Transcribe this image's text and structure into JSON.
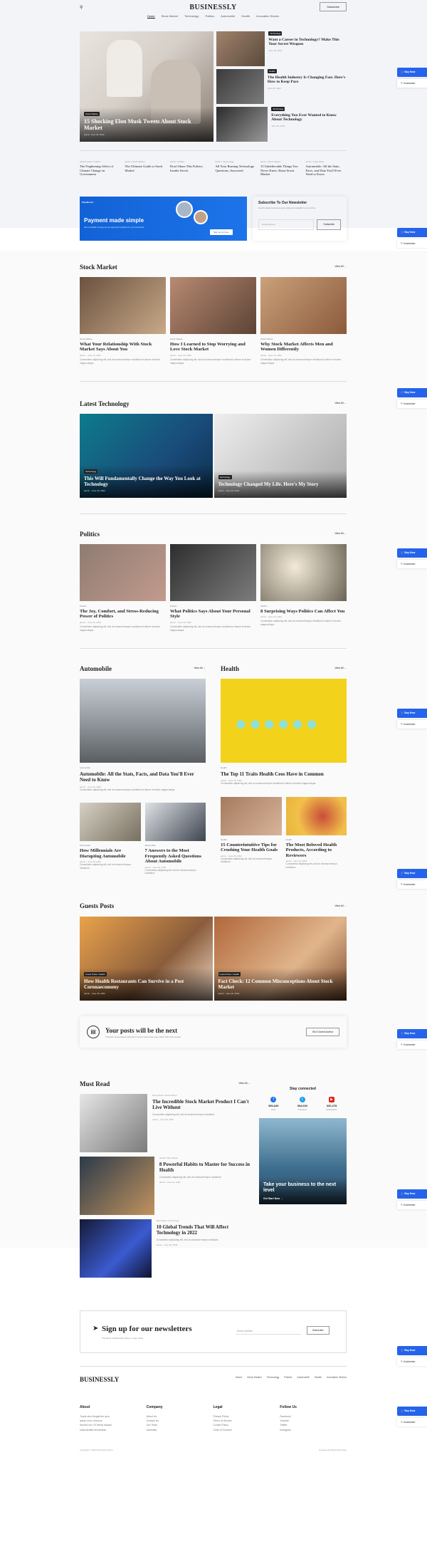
{
  "header": {
    "logo": "BUSINESSLY",
    "subscribe": "Subscribe",
    "nav": [
      "Home",
      "Stock Market",
      "Technology",
      "Politics",
      "Automobile",
      "Health",
      "Innovation Stories"
    ]
  },
  "hero": {
    "main": {
      "tag": "Stock Market",
      "title": "15 Shocking Elon Musk Tweets About Stock Market",
      "author": "admin",
      "date": "June 26, 2022"
    },
    "side": [
      {
        "tag": "Technology",
        "title": "Want a Career in Technology? Make This Your Secret Weapon",
        "date": "June 26, 2022"
      },
      {
        "tag": "Health",
        "title": "The Health Industry Is Changing Fast. Here's How to Keep Pace",
        "date": "June 26, 2022"
      },
      {
        "tag": "Technology",
        "title": "Everything You Ever Wanted to Know About Technology",
        "date": "June 26, 2022"
      }
    ]
  },
  "ticker": [
    {
      "meta": "Global Goals / Politics",
      "title": "The Frightening Affect of Climate Change on Government"
    },
    {
      "meta": "admin / Stock Market",
      "title": "The Ultimate Guide to Stock Market"
    },
    {
      "meta": "admin / Politics",
      "title": "Don't Share This Politics Insider Secret"
    },
    {
      "meta": "admin / Technology",
      "title": "All Your Burning Technology Questions, Answered"
    },
    {
      "meta": "admin / Stock Market",
      "title": "15 Unbelievable Things You Never Knew About Stock Market"
    },
    {
      "meta": "admin / Automobile",
      "title": "Automobile: All the Stats, Facts, and Data You'll Ever Need to Know"
    }
  ],
  "ad": {
    "brand": "PayoBoard",
    "title": "Payment made simple",
    "desc": "Get a reliable & easy-to-use payment solution for your business.",
    "button": "Sign up for Free"
  },
  "newsletter": {
    "title": "Subscribe To Our Newsletter",
    "desc": "Get the latest business news delivered straight to your inbox.",
    "placeholder": "Email address",
    "button": "Subscribe"
  },
  "view_all": "View All",
  "stock": {
    "title": "Stock Market",
    "cards": [
      {
        "cat": "Stock Market",
        "title": "What Your Relationship With Stock Market Says About You",
        "meta": "admin - June 26, 2022",
        "ex": "Consectetur adipiscing elit, sed do eiusmod tempor incididunt ut labore et dolore magna aliqua."
      },
      {
        "cat": "Stock Market",
        "title": "How I Learned to Stop Worrying and Love Stock Market",
        "meta": "admin - June 26, 2022",
        "ex": "Consectetur adipiscing elit, sed do eiusmod tempor incididunt ut labore et dolore magna aliqua."
      },
      {
        "cat": "Stock Market",
        "title": "Why Stock Market Affects Men and Women Differently",
        "meta": "admin - June 26, 2022",
        "ex": "Consectetur adipiscing elit, sed do eiusmod tempor incididunt ut labore et dolore magna aliqua."
      }
    ]
  },
  "tech": {
    "title": "Latest Technology",
    "cards": [
      {
        "tag": "Technology",
        "title": "This Will Fundamentally Change the Way You Look at Technology",
        "meta": "admin - June 26, 2022"
      },
      {
        "tag": "Technology",
        "title": "Technology Changed My Life. Here's My Story",
        "meta": "admin - June 26, 2022"
      }
    ]
  },
  "politics": {
    "title": "Politics",
    "cards": [
      {
        "cat": "Politics",
        "title": "The Joy, Comfort, and Stress-Reducing Power of Politics",
        "meta": "admin - June 26, 2022",
        "ex": "Consectetur adipiscing elit, sed do eiusmod tempor incididunt ut labore et dolore magna aliqua."
      },
      {
        "cat": "Politics",
        "title": "What Politics Says About Your Personal Style",
        "meta": "admin - June 26, 2022",
        "ex": "Consectetur adipiscing elit, sed do eiusmod tempor incididunt ut labore et dolore magna aliqua."
      },
      {
        "cat": "Politics",
        "title": "8 Surprising Ways Politics Can Affect You",
        "meta": "admin - June 26, 2022",
        "ex": "Consectetur adipiscing elit, sed do eiusmod tempor incididunt ut labore et dolore magna aliqua."
      }
    ]
  },
  "auto": {
    "title": "Automobile",
    "big": {
      "cat": "Automobile",
      "title": "Automobile: All the Stats, Facts, and Data You'll Ever Need to Know",
      "meta": "admin - June 26, 2022",
      "ex": "Consectetur adipiscing elit, sed do eiusmod tempor incididunt ut labore et dolore magna aliqua."
    },
    "small": [
      {
        "cat": "Automobile",
        "title": "How Millennials Are Disrupting Automobile",
        "meta": "admin - June 26, 2022",
        "ex": "Consectetur adipiscing elit, sed do eiusmod tempor incididunt."
      },
      {
        "cat": "Automobile",
        "title": "7 Answers to the Most Frequently Asked Questions About Automobile",
        "meta": "admin - June 26, 2022",
        "ex": "Consectetur adipiscing elit, sed do eiusmod tempor incididunt."
      }
    ]
  },
  "health": {
    "title": "Health",
    "big": {
      "cat": "Health",
      "title": "The Top 11 Traits Health Ceos Have in Common",
      "meta": "admin - June 26, 2022",
      "ex": "Consectetur adipiscing elit, sed do eiusmod tempor incididunt ut labore et dolore magna aliqua."
    },
    "small": [
      {
        "cat": "Health",
        "title": "15 Counterintuitive Tips for Crushing Your Health Goals",
        "meta": "admin - June 26, 2022",
        "ex": "Consectetur adipiscing elit, sed do eiusmod tempor incididunt."
      },
      {
        "cat": "Health",
        "title": "The Most Beloved Health Products, According to Reviewers",
        "meta": "admin - June 26, 2022",
        "ex": "Consectetur adipiscing elit, sed do eiusmod tempor incididunt."
      }
    ]
  },
  "guests": {
    "title": "Guests Posts",
    "cards": [
      {
        "tag": "Guest Posts / Health",
        "title": "How Health Restaurants Can Survive in a Post Coronaeconomy",
        "meta": "admin - June 26, 2022"
      },
      {
        "tag": "Guest Posts / Health",
        "title": "Fact Check: 12 Common Misconceptions About Stock Market",
        "meta": "admin - June 26, 2022"
      }
    ]
  },
  "guestbanner": {
    "title": "Your posts will be the next",
    "desc": "Tincidunt suspendisse bibendum tempor accumsan eget tellus nibh dolor augue.",
    "button": "Be A Guest Author"
  },
  "mustread": {
    "title": "Must Read",
    "items": [
      {
        "meta": "Must Read / Stock Market",
        "title": "The Incredible Stock Market Product I Can't Live Without",
        "ex": "Consectetur adipiscing elit, sed do eiusmod tempor incididunt.",
        "date": "admin - June 26, 2022"
      },
      {
        "meta": "Health / Must Read",
        "title": "8 Powerful Habits to Master for Success in Health",
        "ex": "Consectetur adipiscing elit, sed do eiusmod tempor incididunt.",
        "date": "admin - June 26, 2022"
      },
      {
        "meta": "Must Read / Technology",
        "title": "10 Global Trends That Will Affect Technology in 2022",
        "ex": "Consectetur adipiscing elit, sed do eiusmod tempor incididunt.",
        "date": "admin - June 26, 2022"
      }
    ]
  },
  "social": {
    "title": "Stay connected",
    "items": [
      {
        "n": "356,640",
        "l": "Fans",
        "c": "#1877f2"
      },
      {
        "n": "304,604",
        "l": "Followers",
        "c": "#1da1f2"
      },
      {
        "n": "320,278",
        "l": "Subscribers",
        "c": "#e62117"
      }
    ]
  },
  "promo": {
    "title": "Take your business to the next level",
    "cta": "Get Start Now"
  },
  "bignl": {
    "title": "Sign up for our newsletters",
    "desc": "The latest of Businessly Shop, in your inbox.",
    "placeholder": "Email address",
    "button": "Subscribe"
  },
  "footer": {
    "logo": "BUSINESSLY",
    "nav": [
      "Home",
      "Stock Market",
      "Technology",
      "Politics",
      "Automobile",
      "Health",
      "Innovation Stories"
    ],
    "cols": [
      {
        "h": "About",
        "lines": [
          "Turpis eius feugiat leo arcu",
          "ipsum nunc rhoncus",
          "laoreet non. Et metus aliquet.",
          "nulla facilisis fermentum."
        ]
      },
      {
        "h": "Company",
        "lines": [
          "About Us",
          "Contact Us",
          "Our Team",
          "Advertise"
        ]
      },
      {
        "h": "Legal",
        "lines": [
          "Privacy Policy",
          "Terms of Service",
          "Cookie Policy",
          "Code of Conduct"
        ]
      },
      {
        "h": "Follow Us",
        "lines": [
          "Facebook",
          "Youtube",
          "Twitter",
          "Instagram"
        ]
      }
    ],
    "copy": "Copyright © 2022 Businessly Shop",
    "credit": "Powered by Businessly Shop"
  },
  "side": {
    "buy": "Buy Now",
    "customize": "Customize"
  }
}
